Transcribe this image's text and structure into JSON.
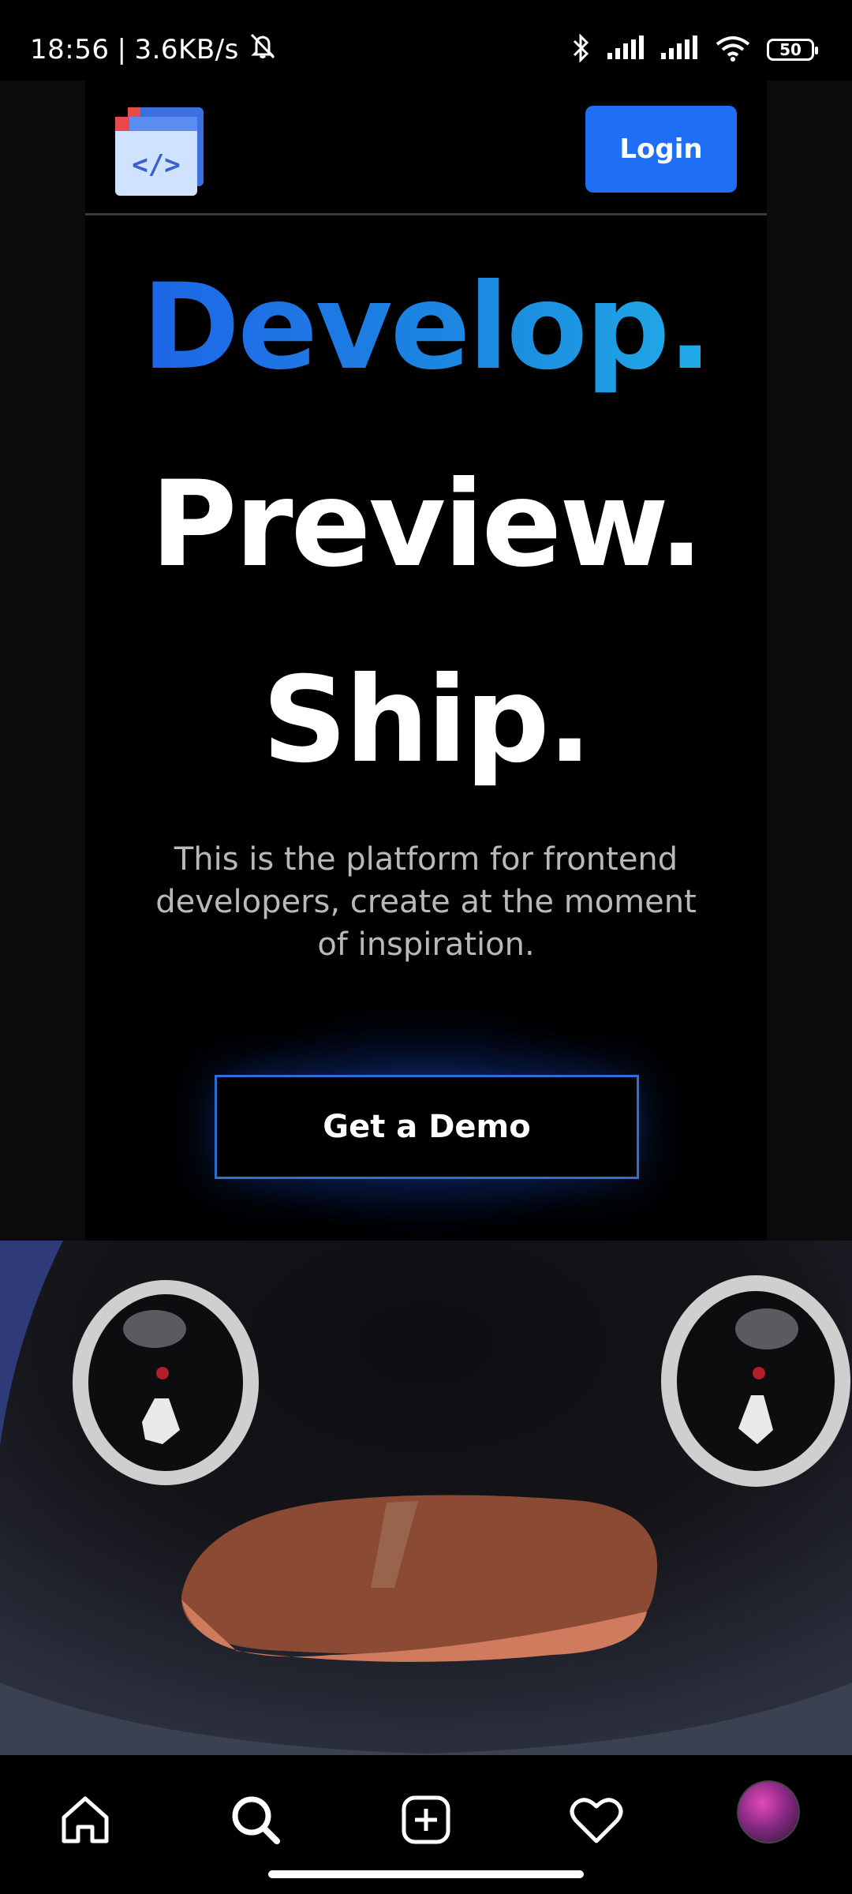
{
  "status_bar": {
    "time": "18:56",
    "separator": "|",
    "network_speed": "3.6KB/s",
    "battery": "50",
    "icons": [
      "mute-icon",
      "bluetooth-icon",
      "signal-icon",
      "signal-icon",
      "wifi-icon",
      "battery-icon"
    ]
  },
  "site": {
    "logo_icon": "code-window-icon",
    "login_label": "Login",
    "headline_1": "Develop.",
    "headline_2": "Preview.",
    "headline_3": "Ship.",
    "tagline": "This is the platform for frontend developers, create at the moment of inspiration.",
    "demo_label": "Get a Demo",
    "colors": {
      "accent": "#1e6ff5",
      "gradient_start": "#1f5fe8",
      "gradient_end": "#24b6ea"
    }
  },
  "bottom_nav": {
    "items": [
      "home-icon",
      "search-icon",
      "create-icon",
      "heart-icon",
      "profile-avatar"
    ]
  }
}
